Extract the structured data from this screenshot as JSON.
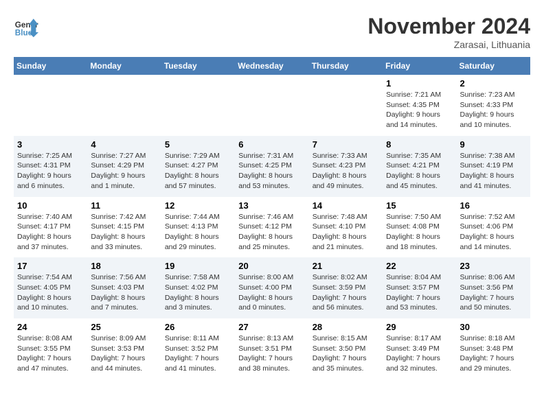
{
  "app": {
    "name": "GeneralBlue",
    "logo_color": "#4a90c4"
  },
  "header": {
    "month_year": "November 2024",
    "location": "Zarasai, Lithuania"
  },
  "weekdays": [
    "Sunday",
    "Monday",
    "Tuesday",
    "Wednesday",
    "Thursday",
    "Friday",
    "Saturday"
  ],
  "weeks": [
    [
      {
        "day": "",
        "info": ""
      },
      {
        "day": "",
        "info": ""
      },
      {
        "day": "",
        "info": ""
      },
      {
        "day": "",
        "info": ""
      },
      {
        "day": "",
        "info": ""
      },
      {
        "day": "1",
        "info": "Sunrise: 7:21 AM\nSunset: 4:35 PM\nDaylight: 9 hours and 14 minutes."
      },
      {
        "day": "2",
        "info": "Sunrise: 7:23 AM\nSunset: 4:33 PM\nDaylight: 9 hours and 10 minutes."
      }
    ],
    [
      {
        "day": "3",
        "info": "Sunrise: 7:25 AM\nSunset: 4:31 PM\nDaylight: 9 hours and 6 minutes."
      },
      {
        "day": "4",
        "info": "Sunrise: 7:27 AM\nSunset: 4:29 PM\nDaylight: 9 hours and 1 minute."
      },
      {
        "day": "5",
        "info": "Sunrise: 7:29 AM\nSunset: 4:27 PM\nDaylight: 8 hours and 57 minutes."
      },
      {
        "day": "6",
        "info": "Sunrise: 7:31 AM\nSunset: 4:25 PM\nDaylight: 8 hours and 53 minutes."
      },
      {
        "day": "7",
        "info": "Sunrise: 7:33 AM\nSunset: 4:23 PM\nDaylight: 8 hours and 49 minutes."
      },
      {
        "day": "8",
        "info": "Sunrise: 7:35 AM\nSunset: 4:21 PM\nDaylight: 8 hours and 45 minutes."
      },
      {
        "day": "9",
        "info": "Sunrise: 7:38 AM\nSunset: 4:19 PM\nDaylight: 8 hours and 41 minutes."
      }
    ],
    [
      {
        "day": "10",
        "info": "Sunrise: 7:40 AM\nSunset: 4:17 PM\nDaylight: 8 hours and 37 minutes."
      },
      {
        "day": "11",
        "info": "Sunrise: 7:42 AM\nSunset: 4:15 PM\nDaylight: 8 hours and 33 minutes."
      },
      {
        "day": "12",
        "info": "Sunrise: 7:44 AM\nSunset: 4:13 PM\nDaylight: 8 hours and 29 minutes."
      },
      {
        "day": "13",
        "info": "Sunrise: 7:46 AM\nSunset: 4:12 PM\nDaylight: 8 hours and 25 minutes."
      },
      {
        "day": "14",
        "info": "Sunrise: 7:48 AM\nSunset: 4:10 PM\nDaylight: 8 hours and 21 minutes."
      },
      {
        "day": "15",
        "info": "Sunrise: 7:50 AM\nSunset: 4:08 PM\nDaylight: 8 hours and 18 minutes."
      },
      {
        "day": "16",
        "info": "Sunrise: 7:52 AM\nSunset: 4:06 PM\nDaylight: 8 hours and 14 minutes."
      }
    ],
    [
      {
        "day": "17",
        "info": "Sunrise: 7:54 AM\nSunset: 4:05 PM\nDaylight: 8 hours and 10 minutes."
      },
      {
        "day": "18",
        "info": "Sunrise: 7:56 AM\nSunset: 4:03 PM\nDaylight: 8 hours and 7 minutes."
      },
      {
        "day": "19",
        "info": "Sunrise: 7:58 AM\nSunset: 4:02 PM\nDaylight: 8 hours and 3 minutes."
      },
      {
        "day": "20",
        "info": "Sunrise: 8:00 AM\nSunset: 4:00 PM\nDaylight: 8 hours and 0 minutes."
      },
      {
        "day": "21",
        "info": "Sunrise: 8:02 AM\nSunset: 3:59 PM\nDaylight: 7 hours and 56 minutes."
      },
      {
        "day": "22",
        "info": "Sunrise: 8:04 AM\nSunset: 3:57 PM\nDaylight: 7 hours and 53 minutes."
      },
      {
        "day": "23",
        "info": "Sunrise: 8:06 AM\nSunset: 3:56 PM\nDaylight: 7 hours and 50 minutes."
      }
    ],
    [
      {
        "day": "24",
        "info": "Sunrise: 8:08 AM\nSunset: 3:55 PM\nDaylight: 7 hours and 47 minutes."
      },
      {
        "day": "25",
        "info": "Sunrise: 8:09 AM\nSunset: 3:53 PM\nDaylight: 7 hours and 44 minutes."
      },
      {
        "day": "26",
        "info": "Sunrise: 8:11 AM\nSunset: 3:52 PM\nDaylight: 7 hours and 41 minutes."
      },
      {
        "day": "27",
        "info": "Sunrise: 8:13 AM\nSunset: 3:51 PM\nDaylight: 7 hours and 38 minutes."
      },
      {
        "day": "28",
        "info": "Sunrise: 8:15 AM\nSunset: 3:50 PM\nDaylight: 7 hours and 35 minutes."
      },
      {
        "day": "29",
        "info": "Sunrise: 8:17 AM\nSunset: 3:49 PM\nDaylight: 7 hours and 32 minutes."
      },
      {
        "day": "30",
        "info": "Sunrise: 8:18 AM\nSunset: 3:48 PM\nDaylight: 7 hours and 29 minutes."
      }
    ]
  ]
}
